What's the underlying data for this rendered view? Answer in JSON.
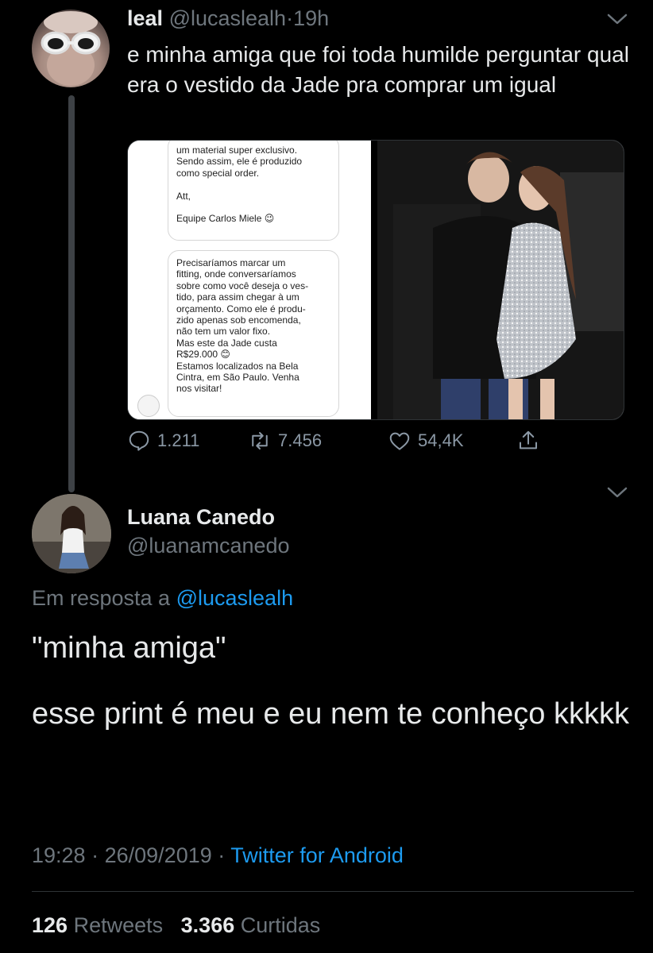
{
  "parent": {
    "name": "leal",
    "handle": "@lucaslealh",
    "separator": "·",
    "time": "19h",
    "text": "e minha amiga que foi toda humilde perguntar qual era o vestido da Jade pra comprar um igual",
    "media_text": {
      "bubble1": "um material super exclusivo.\nSendo assim, ele é produzido\ncomo special order.\n\nAtt,\n\nEquipe Carlos Miele 😉",
      "bubble2": "Precisaríamos marcar um\nfitting, onde conversaríamos\nsobre como você deseja o ves-\ntido, para assim chegar à um\norçamento. Como ele é produ-\nzido apenas sob encomenda,\nnão tem um valor fixo.\nMas este da Jade custa\nR$29.000 😊\nEstamos localizados na Bela\nCintra, em São Paulo. Venha\nnos visitar!"
    },
    "actions": {
      "replies": "1.211",
      "retweets": "7.456",
      "likes": "54,4K"
    },
    "icons": [
      "chevron-down-icon",
      "reply-icon",
      "retweet-icon",
      "like-icon",
      "share-icon"
    ]
  },
  "reply": {
    "name": "Luana Canedo",
    "handle": "@luanamcanedo",
    "reply_prefix": "Em resposta a",
    "reply_to": "@lucaslealh",
    "line1": "\"minha amiga\"",
    "line2": "esse print é meu e eu nem te conheço kkkkk",
    "time": "19:28",
    "dot1": "·",
    "date": "26/09/2019",
    "dot2": "·",
    "source": "Twitter for Android",
    "retweets_count": "126",
    "retweets_label": "Retweets",
    "likes_count": "3.366",
    "likes_label": "Curtidas"
  },
  "colors": {
    "background": "#000000",
    "text": "#e7e9ea",
    "muted": "#6e767d",
    "link": "#1d9bf0"
  }
}
